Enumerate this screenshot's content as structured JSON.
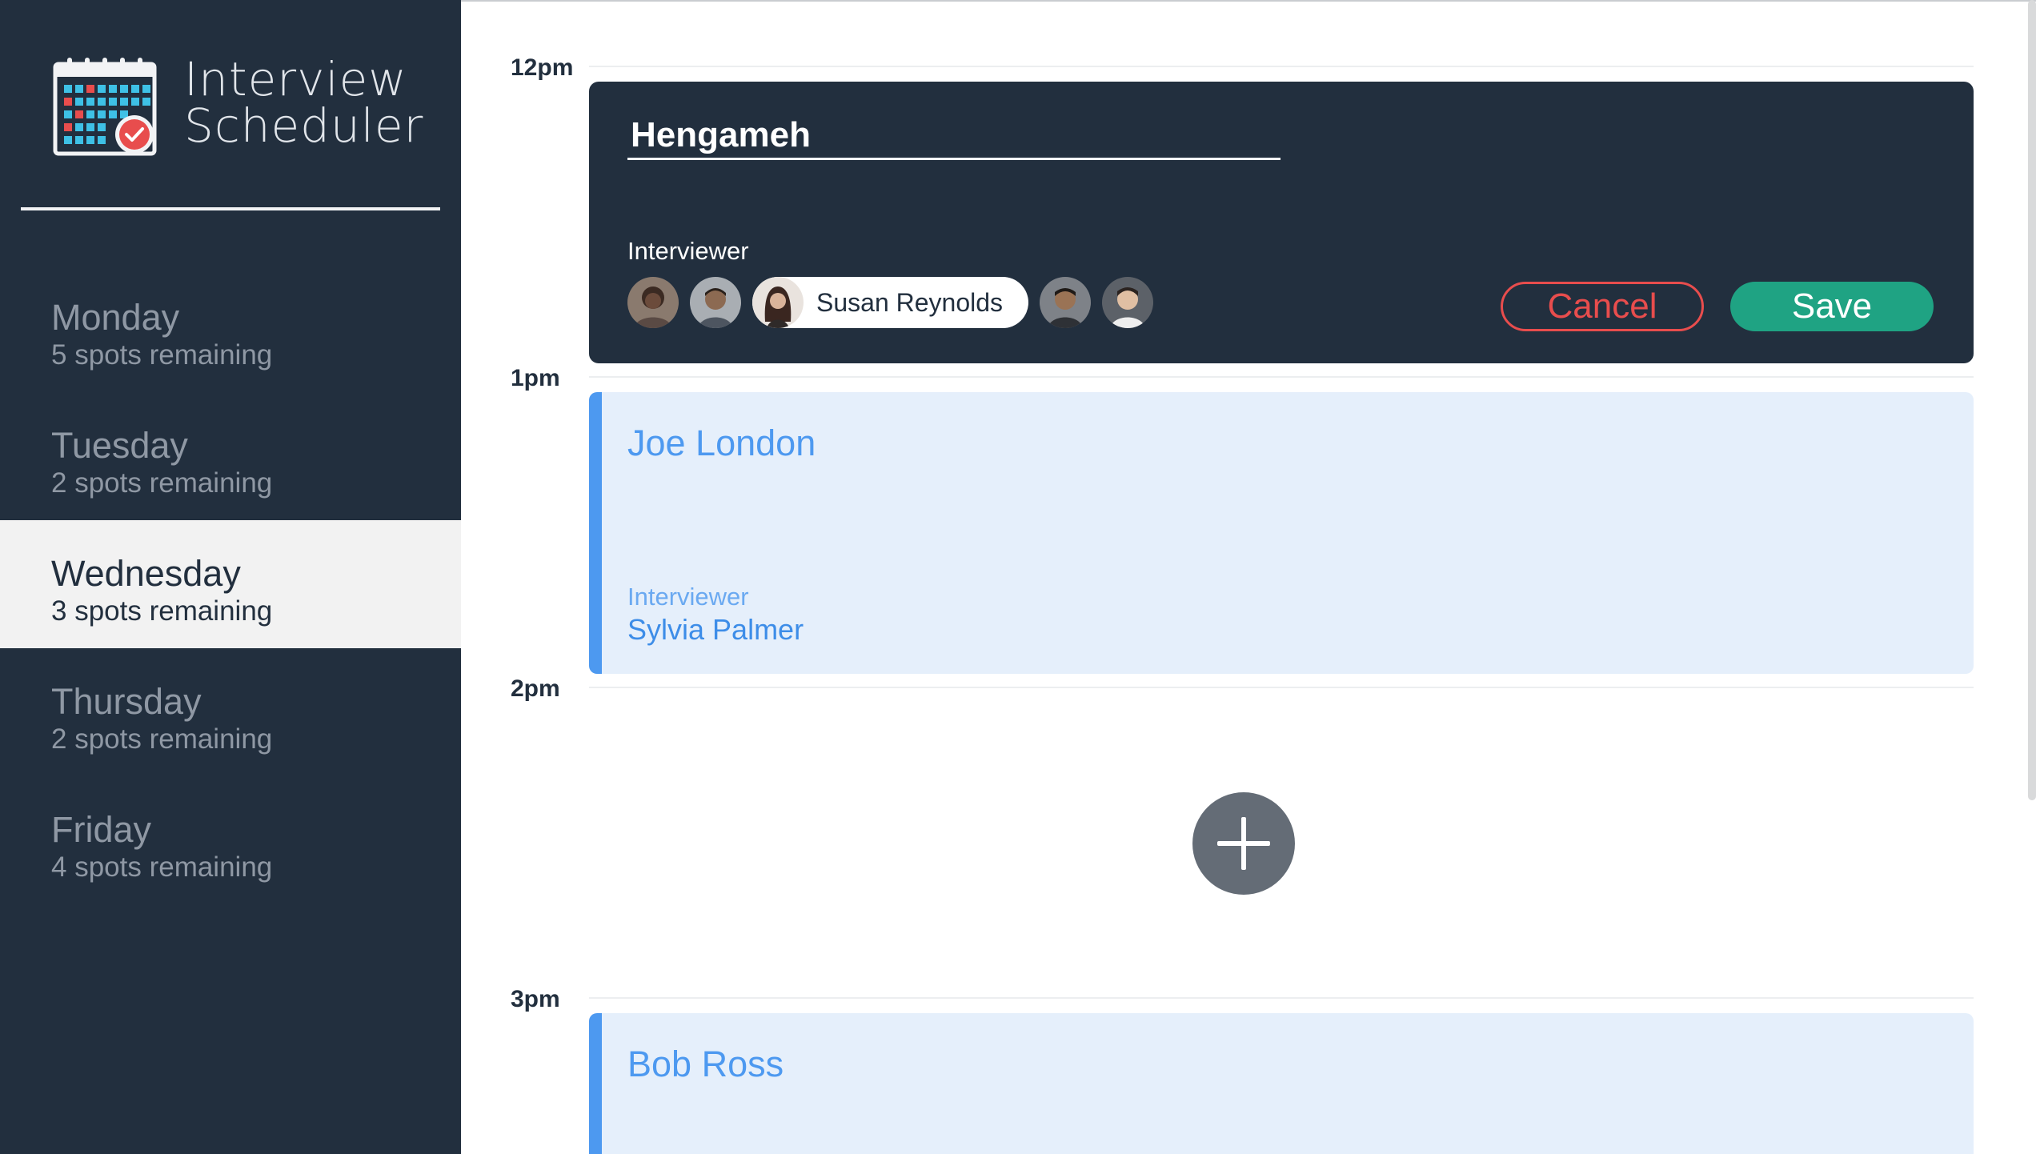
{
  "app": {
    "title_line1": "Interview",
    "title_line2": "Scheduler"
  },
  "days": [
    {
      "name": "Monday",
      "spots": "5 spots remaining",
      "selected": false
    },
    {
      "name": "Tuesday",
      "spots": "2 spots remaining",
      "selected": false
    },
    {
      "name": "Wednesday",
      "spots": "3 spots remaining",
      "selected": true
    },
    {
      "name": "Thursday",
      "spots": "2 spots remaining",
      "selected": false
    },
    {
      "name": "Friday",
      "spots": "4 spots remaining",
      "selected": false
    }
  ],
  "schedule": {
    "times": [
      "12pm",
      "1pm",
      "2pm",
      "3pm"
    ]
  },
  "form": {
    "student_name": "Hengameh",
    "interviewer_label": "Interviewer",
    "selected_interviewer": "Susan Reynolds",
    "cancel_label": "Cancel",
    "save_label": "Save"
  },
  "appointments": [
    {
      "student": "Joe London",
      "interviewer_label": "Interviewer",
      "interviewer": "Sylvia Palmer"
    },
    {
      "student": "Bob Ross"
    }
  ],
  "colors": {
    "sidebar_bg": "#222f3e",
    "selected_day_bg": "#f2f2f2",
    "appointment_bg": "#e5effb",
    "appointment_accent": "#4d99f0",
    "cancel": "#e84d4d",
    "save": "#1fa383",
    "add_button": "#646c76"
  },
  "icons": {
    "logo": "calendar-check-icon",
    "add": "plus-icon"
  }
}
